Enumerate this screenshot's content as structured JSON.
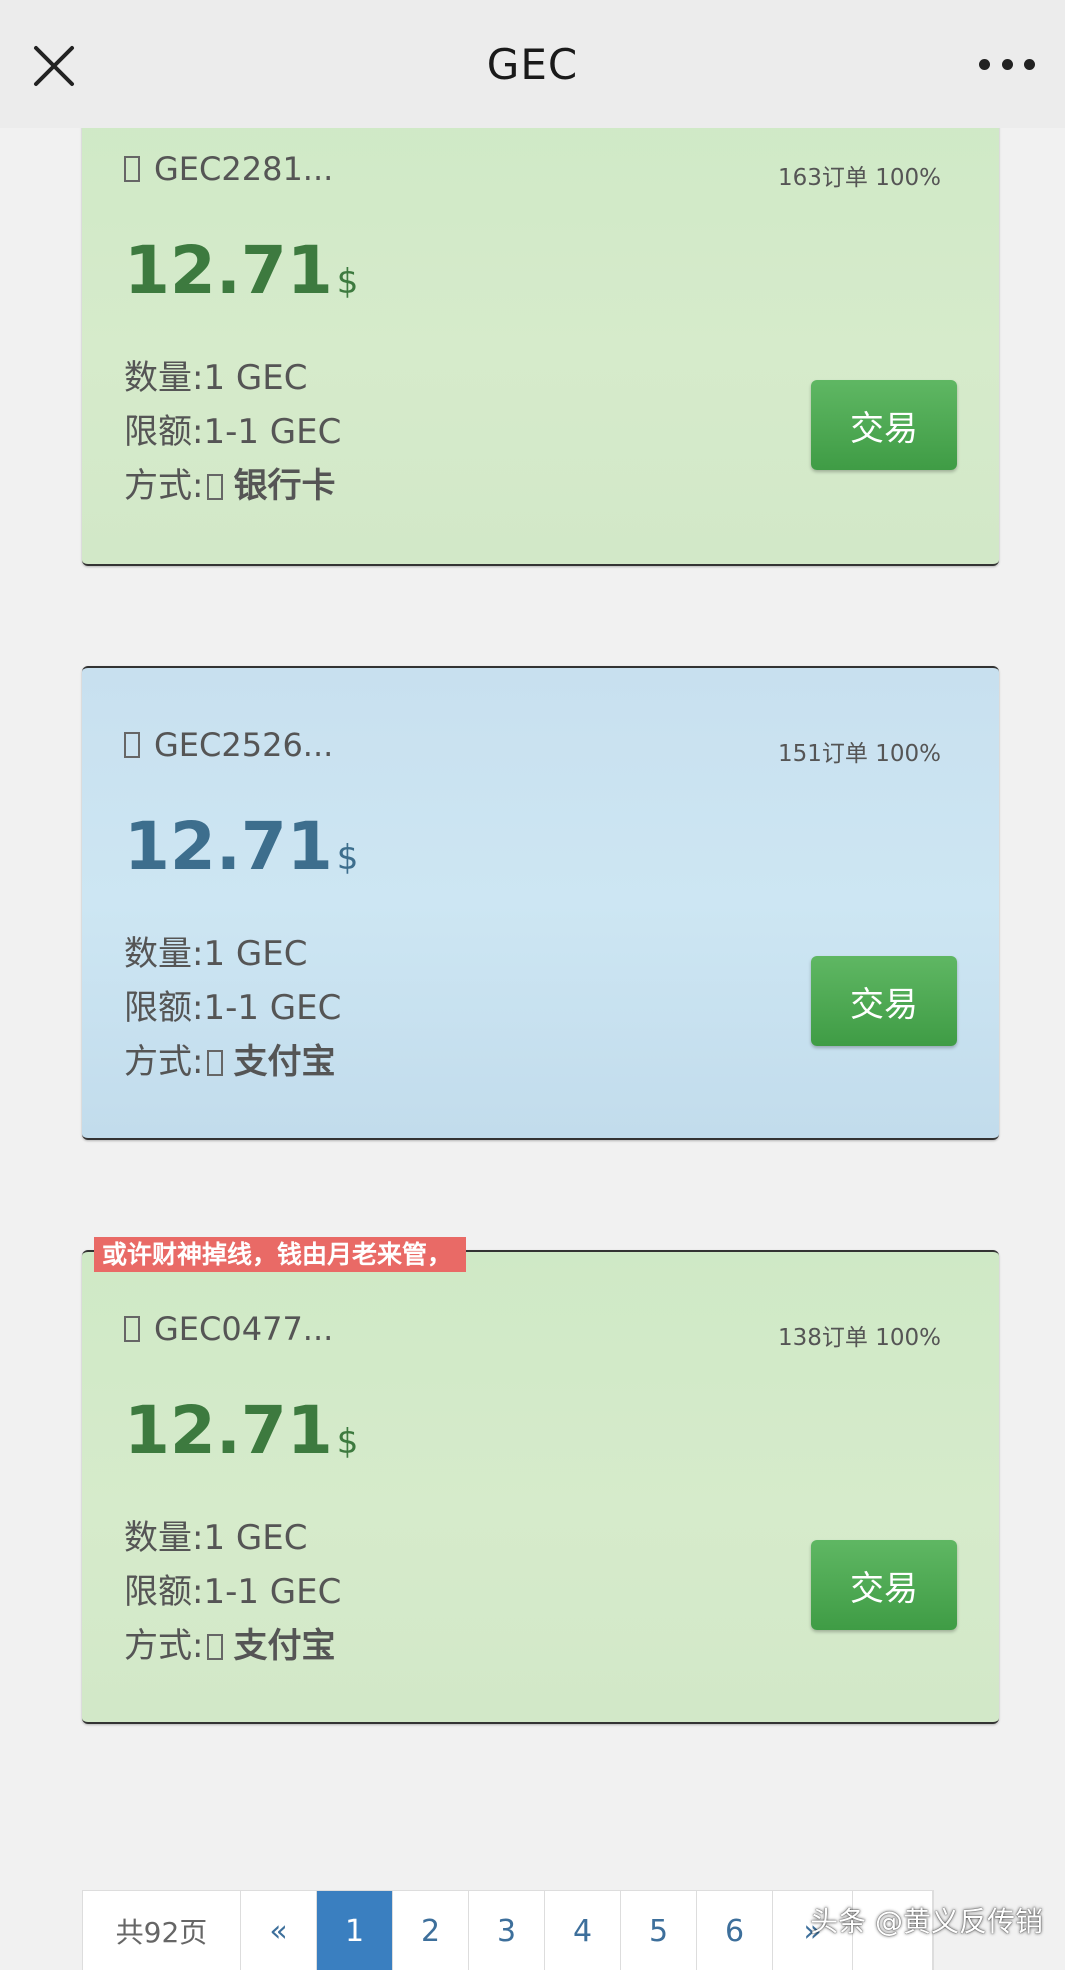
{
  "nav": {
    "title": "GEC"
  },
  "orders": [
    {
      "seller": "GEC2281...",
      "stats": "163订单 100%",
      "price": "12.71",
      "currency": "$",
      "qty_label": "数量:",
      "qty_value": "1 GEC",
      "limit_label": "限额:",
      "limit_value": "1-1 GEC",
      "method_label": "方式:",
      "method_value": "银行卡",
      "trade_label": "交易",
      "theme": "green"
    },
    {
      "seller": "GEC2526...",
      "stats": "151订单 100%",
      "price": "12.71",
      "currency": "$",
      "qty_label": "数量:",
      "qty_value": "1 GEC",
      "limit_label": "限额:",
      "limit_value": "1-1 GEC",
      "method_label": "方式:",
      "method_value": "支付宝",
      "trade_label": "交易",
      "theme": "blue"
    },
    {
      "seller": "GEC0477...",
      "stats": "138订单 100%",
      "price": "12.71",
      "currency": "$",
      "qty_label": "数量:",
      "qty_value": "1 GEC",
      "limit_label": "限额:",
      "limit_value": "1-1 GEC",
      "method_label": "方式:",
      "method_value": "支付宝",
      "trade_label": "交易",
      "theme": "green"
    }
  ],
  "overlay_note": "或许财神掉线，钱由月老来管，",
  "pagination": {
    "total": "共92页",
    "prev": "«",
    "pages": [
      "1",
      "2",
      "3",
      "4",
      "5",
      "6"
    ],
    "active": "1",
    "next": "»"
  },
  "watermark": "头条 @黄义反传销"
}
